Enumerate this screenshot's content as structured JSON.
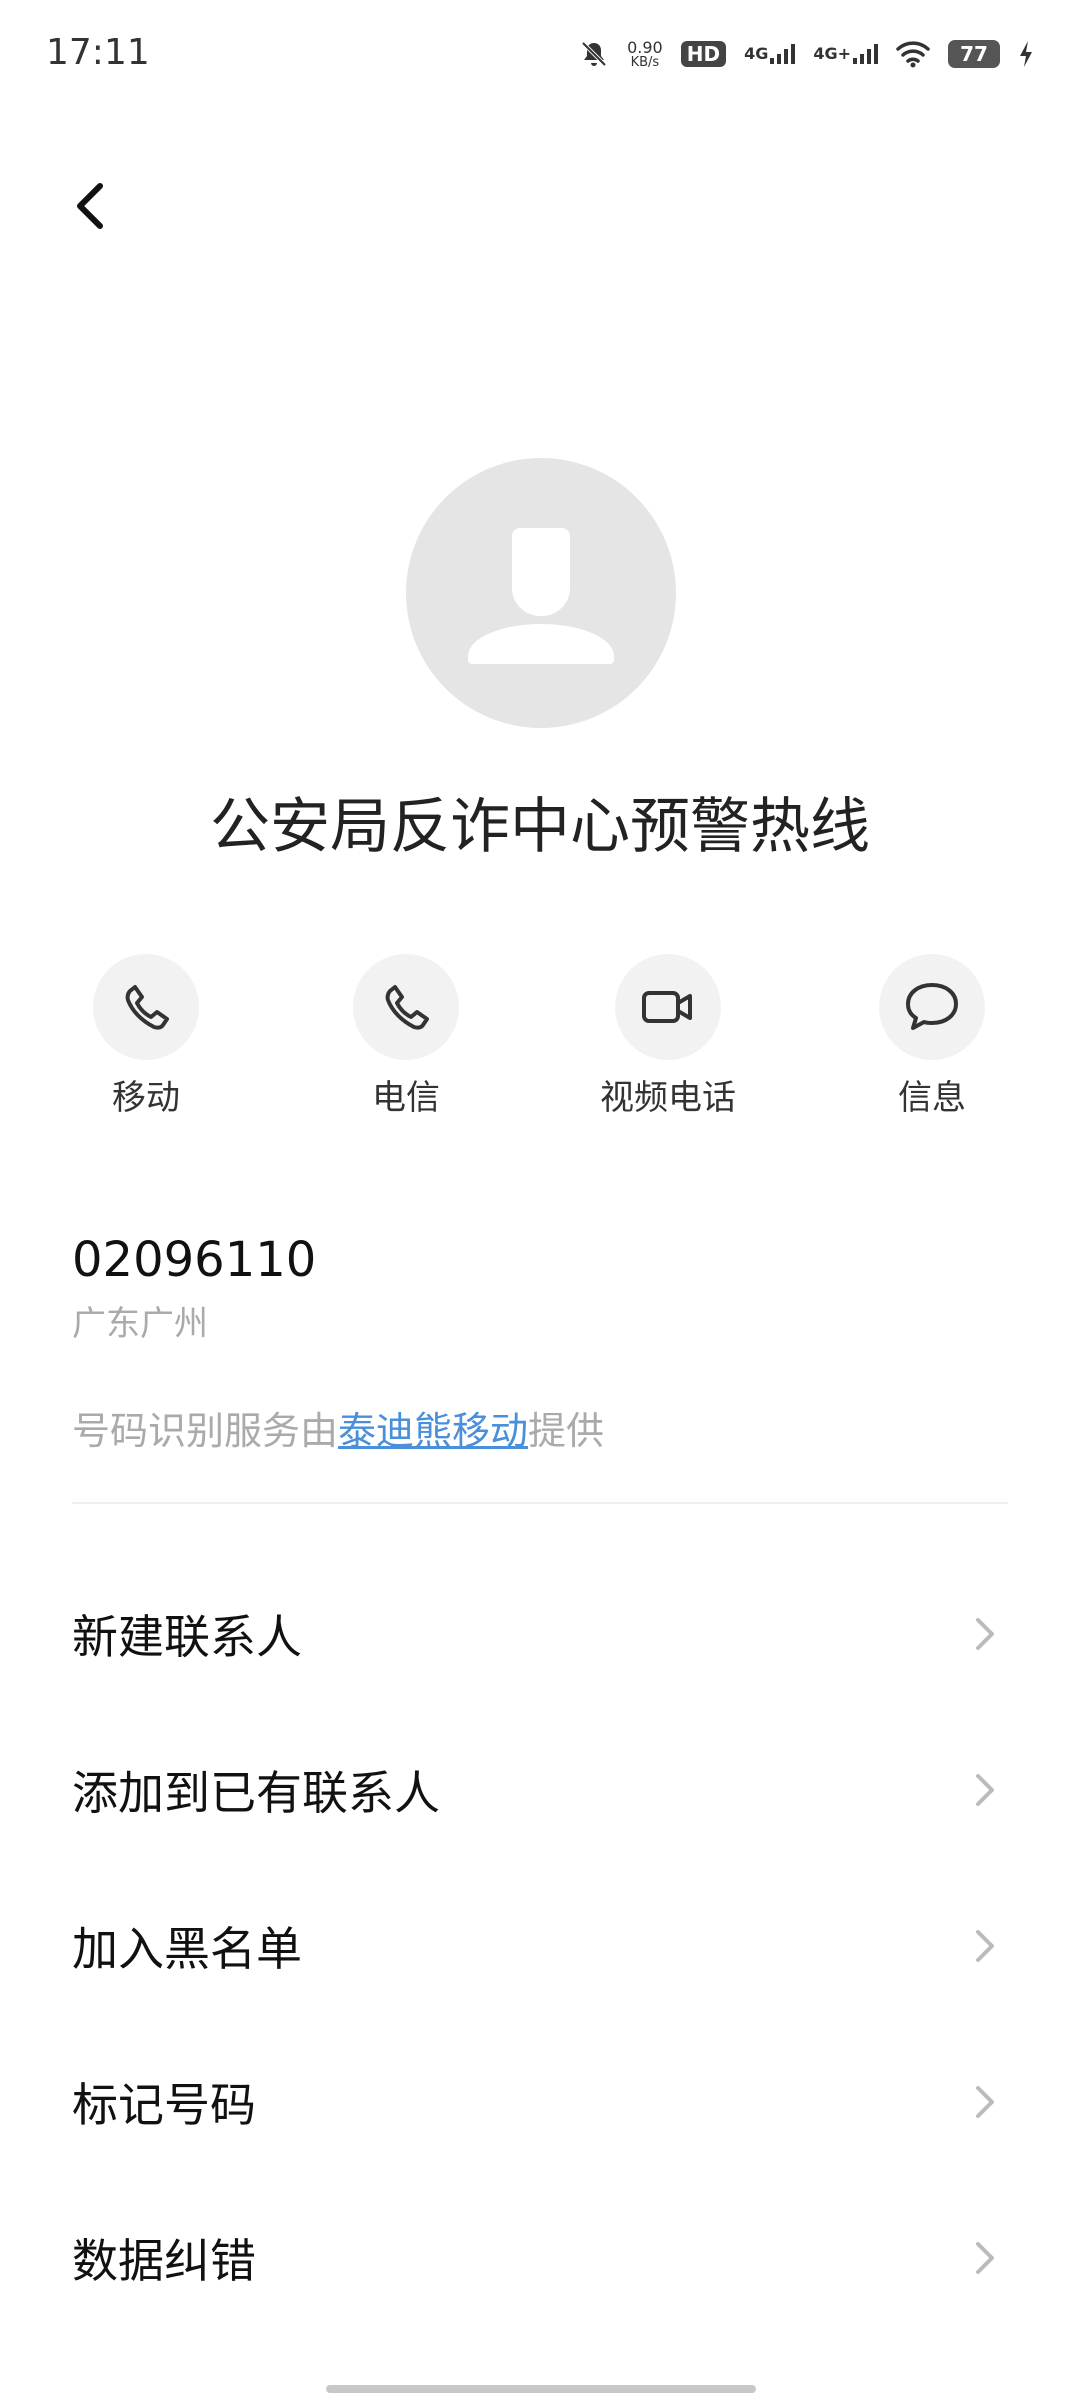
{
  "status_bar": {
    "time": "17:11",
    "speed_value": "0.90",
    "speed_unit": "KB/s",
    "hd": "HD",
    "sim1": "4G",
    "sim2": "4G+",
    "battery": "77"
  },
  "contact": {
    "name": "公安局反诈中心预警热线",
    "number": "02096110",
    "location": "广东广州"
  },
  "actions": [
    {
      "label": "移动",
      "icon": "phone-icon"
    },
    {
      "label": "电信",
      "icon": "phone-icon"
    },
    {
      "label": "视频电话",
      "icon": "video-camera-icon"
    },
    {
      "label": "信息",
      "icon": "message-bubble-icon"
    }
  ],
  "provider": {
    "prefix": "号码识别服务由",
    "link": "泰迪熊移动",
    "suffix": "提供"
  },
  "menu": [
    {
      "label": "新建联系人"
    },
    {
      "label": "添加到已有联系人"
    },
    {
      "label": "加入黑名单"
    },
    {
      "label": "标记号码"
    },
    {
      "label": "数据纠错"
    }
  ],
  "colors": {
    "accent_link": "#4a8fd9",
    "avatar_bg": "#e5e5e5",
    "secondary_text": "#aaaaaa"
  }
}
